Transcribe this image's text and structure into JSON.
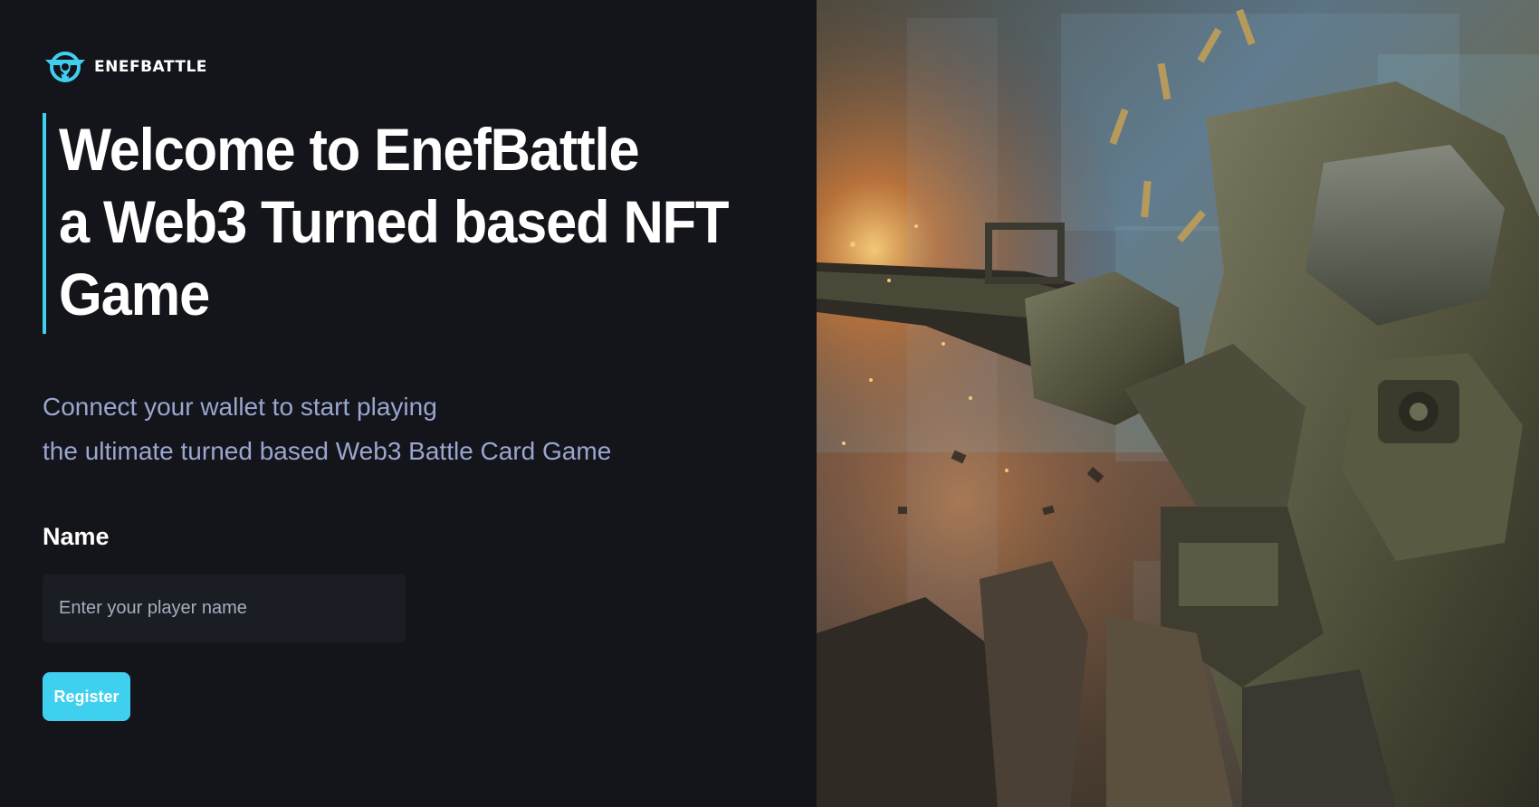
{
  "brand": {
    "name": "ENEFBATTLE",
    "accent": "#3fd0f0",
    "logo_icon": "enefbattle-logo-icon"
  },
  "hero": {
    "lines": [
      "Welcome to EnefBattle",
      "a Web3 Turned based NFT",
      "Game"
    ]
  },
  "subtitle": {
    "lines": [
      "Connect your wallet to start playing",
      "the ultimate turned based Web3 Battle Card Game"
    ]
  },
  "form": {
    "name_label": "Name",
    "name_placeholder": "Enter your player name",
    "name_value": "",
    "register_label": "Register"
  },
  "artwork": {
    "subject": "battle-mech-artwork"
  }
}
